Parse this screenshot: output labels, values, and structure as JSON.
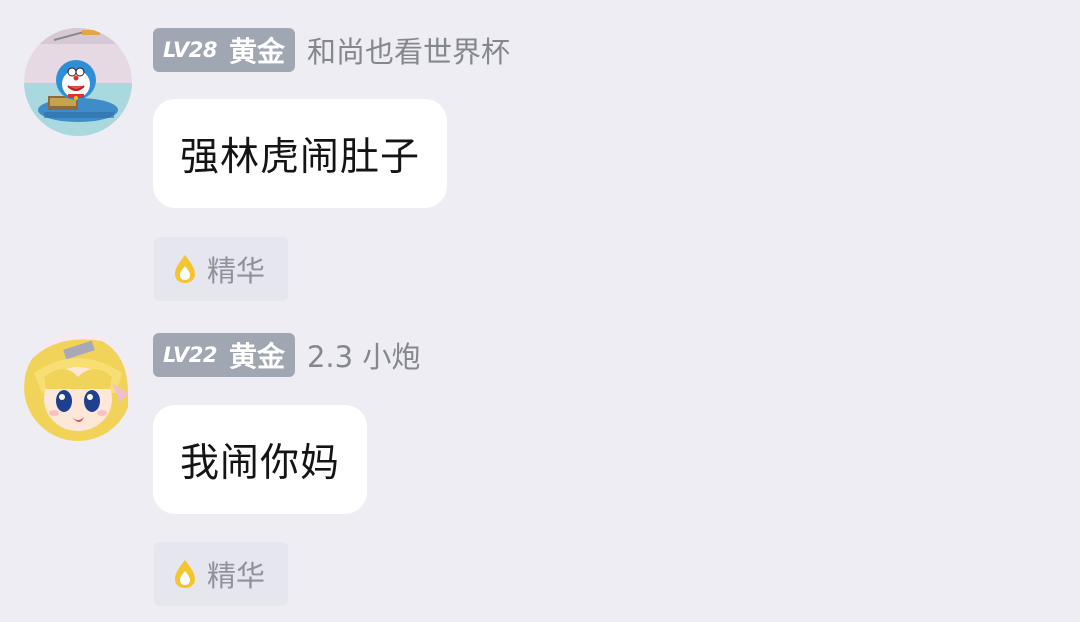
{
  "comments": [
    {
      "level": "LV28",
      "rank": "黄金",
      "nickname": "和尚也看世界杯",
      "text": "强林虎闹肚子",
      "tag": "精华",
      "avatar_icon": "doraemon-avatar-icon"
    },
    {
      "level": "LV22",
      "rank": "黄金",
      "nickname": "2.3 小炮",
      "text": "我闹你妈",
      "tag": "精华",
      "avatar_icon": "anime-girl-avatar-icon"
    }
  ],
  "colors": {
    "background": "#ededf3",
    "badge": "#a1a6b3",
    "bubble": "#ffffff",
    "tag_bg": "#e6e6ef",
    "tag_icon": "#f5c431",
    "nickname": "#85878f"
  }
}
